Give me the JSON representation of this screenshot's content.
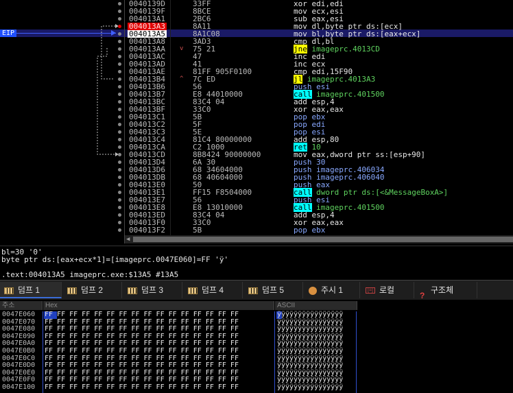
{
  "eip_label": "EIP",
  "disasm": [
    {
      "addr": "0040139D",
      "hex": "33FF",
      "pre": "xor edi,edi"
    },
    {
      "addr": "0040139F",
      "hex": "8BCE",
      "pre": "mov ecx,esi"
    },
    {
      "addr": "004013A1",
      "hex": "2BC6",
      "pre": "sub eax,esi"
    },
    {
      "addr": "004013A3",
      "hex": "8A11",
      "pre": "mov dl,byte ptr ds:[ecx]",
      "bp": true
    },
    {
      "addr": "004013A5",
      "hex": "8A1C08",
      "pre": "mov bl,byte ptr ds:[eax+ecx]",
      "eip": true
    },
    {
      "addr": "004013A8",
      "hex": "3AD3",
      "pre": "cmp dl,bl"
    },
    {
      "addr": "004013AA",
      "hex": "75 21",
      "mark": "v",
      "hl": "jne",
      "hlc": "y",
      "target": "imageprc.4013CD"
    },
    {
      "addr": "004013AC",
      "hex": "47",
      "pre": "inc edi"
    },
    {
      "addr": "004013AD",
      "hex": "41",
      "pre": "inc ecx"
    },
    {
      "addr": "004013AE",
      "hex": "81FF 905F0100",
      "pre": "cmp edi,15F90"
    },
    {
      "addr": "004013B4",
      "hex": "7C ED",
      "mark": "^",
      "hl": "jl",
      "hlc": "y",
      "target": "imageprc.4013A3"
    },
    {
      "addr": "004013B6",
      "hex": "56",
      "push": "push esi"
    },
    {
      "addr": "004013B7",
      "hex": "E8 44010000",
      "hl": "call",
      "hlc": "c",
      "target": "imageprc.401500"
    },
    {
      "addr": "004013BC",
      "hex": "83C4 04",
      "pre": "add esp,4"
    },
    {
      "addr": "004013BF",
      "hex": "33C0",
      "pre": "xor eax,eax"
    },
    {
      "addr": "004013C1",
      "hex": "5B",
      "push": "pop ebx"
    },
    {
      "addr": "004013C2",
      "hex": "5F",
      "push": "pop edi"
    },
    {
      "addr": "004013C3",
      "hex": "5E",
      "push": "pop esi"
    },
    {
      "addr": "004013C4",
      "hex": "81C4 80000000",
      "pre": "add esp,80"
    },
    {
      "addr": "004013CA",
      "hex": "C2 1000",
      "hl": "ret",
      "hlc": "c",
      "target": "10"
    },
    {
      "addr": "004013CD",
      "hex": "8B8424 90000000",
      "pre": "mov eax,dword ptr ss:[esp+90]"
    },
    {
      "addr": "004013D4",
      "hex": "6A 30",
      "push": "push 30"
    },
    {
      "addr": "004013D6",
      "hex": "68 34604000",
      "push": "push imageprc.406034"
    },
    {
      "addr": "004013DB",
      "hex": "68 40604000",
      "push": "push imageprc.406040"
    },
    {
      "addr": "004013E0",
      "hex": "50",
      "push": "push eax"
    },
    {
      "addr": "004013E1",
      "hex": "FF15 F8504000",
      "hl": "call",
      "hlc": "c",
      "target": "dword ptr ds:[<&MessageBoxA>]"
    },
    {
      "addr": "004013E7",
      "hex": "56",
      "push": "push esi"
    },
    {
      "addr": "004013E8",
      "hex": "E8 13010000",
      "hl": "call",
      "hlc": "c",
      "target": "imageprc.401500"
    },
    {
      "addr": "004013ED",
      "hex": "83C4 04",
      "pre": "add esp,4"
    },
    {
      "addr": "004013F0",
      "hex": "33C0",
      "pre": "xor eax,eax"
    },
    {
      "addr": "004013F2",
      "hex": "5B",
      "push": "pop ebx"
    }
  ],
  "info": {
    "line1": "bl=30 '0'",
    "line2": "byte ptr ds:[eax+ecx*1]=[imageprc.0047E060]=FF 'ÿ'",
    "line3": ".text:004013A5 imageprc.exe:$13A5 #13A5"
  },
  "tabs": [
    {
      "label": "덤프 1",
      "icon": "dump",
      "active": true
    },
    {
      "label": "덤프 2",
      "icon": "dump"
    },
    {
      "label": "덤프 3",
      "icon": "dump"
    },
    {
      "label": "덤프 4",
      "icon": "dump"
    },
    {
      "label": "덤프 5",
      "icon": "dump"
    },
    {
      "label": "주시 1",
      "icon": "watch"
    },
    {
      "label": "로컬",
      "icon": "local"
    },
    {
      "label": "구조체",
      "icon": "struct"
    }
  ],
  "dump": {
    "headers": {
      "addr": "주소",
      "hex": "Hex",
      "ascii": "ASCII"
    },
    "hex_line": "FF FF FF FF FF FF FF FF FF FF FF FF FF FF FF FF",
    "ascii_line": "ÿÿÿÿÿÿÿÿÿÿÿÿÿÿÿÿ",
    "rows": [
      "0047E060",
      "0047E070",
      "0047E080",
      "0047E090",
      "0047E0A0",
      "0047E0B0",
      "0047E0C0",
      "0047E0D0",
      "0047E0E0",
      "0047E0F0",
      "0047E100"
    ]
  }
}
